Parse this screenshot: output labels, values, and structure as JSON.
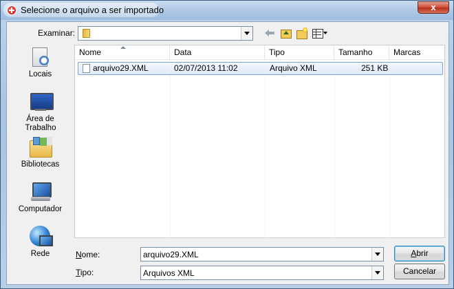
{
  "window": {
    "title": "Selecione o arquivo a ser importado",
    "close_label": "x"
  },
  "toolbar": {
    "look_in_label": "Examinar:",
    "look_in_value": "",
    "icons": [
      "back-arrow-icon",
      "up-folder-icon",
      "new-folder-icon",
      "view-menu-icon"
    ]
  },
  "places": [
    {
      "label": "Locais",
      "icon": "recent-places-icon"
    },
    {
      "label": "Área de Trabalho",
      "icon": "desktop-icon"
    },
    {
      "label": "Bibliotecas",
      "icon": "libraries-icon"
    },
    {
      "label": "Computador",
      "icon": "computer-icon"
    },
    {
      "label": "Rede",
      "icon": "network-icon"
    }
  ],
  "columns": [
    "Nome",
    "Data",
    "Tipo",
    "Tamanho",
    "Marcas"
  ],
  "files": [
    {
      "name": "arquivo29.XML",
      "date": "02/07/2013 11:02",
      "type": "Arquivo XML",
      "size": "251 KB",
      "tags": ""
    }
  ],
  "footer": {
    "name_label_prefix": "",
    "name_label_hotkey": "N",
    "name_label_rest": "ome:",
    "name_value": "arquivo29.XML",
    "type_label_hotkey": "T",
    "type_label_rest": "ipo:",
    "type_value": "Arquivos XML",
    "open_hotkey": "A",
    "open_rest": "brir",
    "cancel_label": "Cancelar"
  }
}
